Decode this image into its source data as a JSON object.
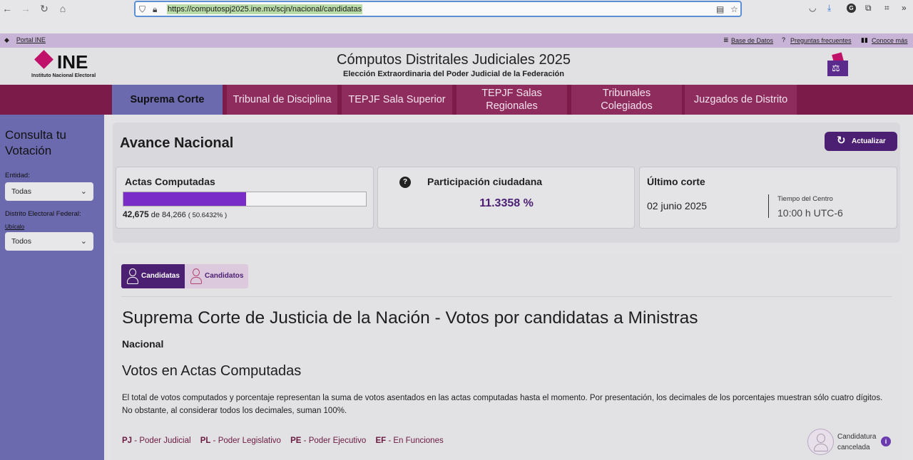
{
  "browser": {
    "url": "https://computospj2025.ine.mx/scjn/nacional/candidatas"
  },
  "util_bar": {
    "portal": "Portal INE",
    "links": [
      "Base de Datos",
      "Preguntas frecuentes",
      "Conoce más"
    ]
  },
  "header": {
    "logo_text": "INE",
    "logo_sub": "Instituto Nacional Electoral",
    "title": "Cómputos Distritales Judiciales 2025",
    "subtitle": "Elección Extraordinaria del Poder Judicial de la Federación"
  },
  "tabs": [
    {
      "label": "Suprema Corte",
      "active": true
    },
    {
      "label": "Tribunal de Disciplina",
      "active": false
    },
    {
      "label": "TEPJF Sala Superior",
      "active": false
    },
    {
      "label": "TEPJF Salas Regionales",
      "active": false
    },
    {
      "label": "Tribunales Colegiados",
      "active": false
    },
    {
      "label": "Juzgados de Distrito",
      "active": false
    }
  ],
  "sidebar": {
    "title": "Consulta tu Votación",
    "entidad_label": "Entidad:",
    "entidad_value": "Todas",
    "distrito_label": "Distrito Electoral Federal:",
    "ubicalo": "Ubícalo",
    "distrito_value": "Todos"
  },
  "avance": {
    "title": "Avance Nacional",
    "refresh_label": "Actualizar",
    "actas": {
      "title": "Actas Computadas",
      "computed": "42,675",
      "of_text": "de 84,266",
      "percent_text": "( 50.6432% )",
      "progress_fraction": 0.506432
    },
    "participacion": {
      "title": "Participación ciudadana",
      "value": "11.3358 %"
    },
    "corte": {
      "title": "Último corte",
      "date": "02 junio 2025",
      "time_label": "Tiempo del Centro",
      "time": "10:00 h UTC-6"
    }
  },
  "main": {
    "switch": {
      "candidatas": "Candidatas",
      "candidatos": "Candidatos"
    },
    "title": "Suprema Corte de Justicia de la Nación - Votos por candidatas a Ministras",
    "scope": "Nacional",
    "section_title": "Votos en Actas Computadas",
    "description": "El total de votos computados y porcentaje representan la suma de votos asentados en las actas computadas hasta el momento. Por presentación, los decimales de los porcentajes muestran sólo cuatro dígitos. No obstante, al considerar todos los decimales, suman 100%.",
    "legend": [
      {
        "code": "PJ",
        "label": "Poder Judicial"
      },
      {
        "code": "PL",
        "label": "Poder Legislativo"
      },
      {
        "code": "PE",
        "label": "Poder Ejecutivo"
      },
      {
        "code": "EF",
        "label": "En Funciones"
      }
    ],
    "cancelada_line1": "Candidatura",
    "cancelada_line2": "cancelada"
  },
  "colors": {
    "tab_bar": "#7a1b49",
    "active_tab": "#6c6aaf",
    "accent_purple": "#4b1f72",
    "progress": "#7a2cc8"
  }
}
